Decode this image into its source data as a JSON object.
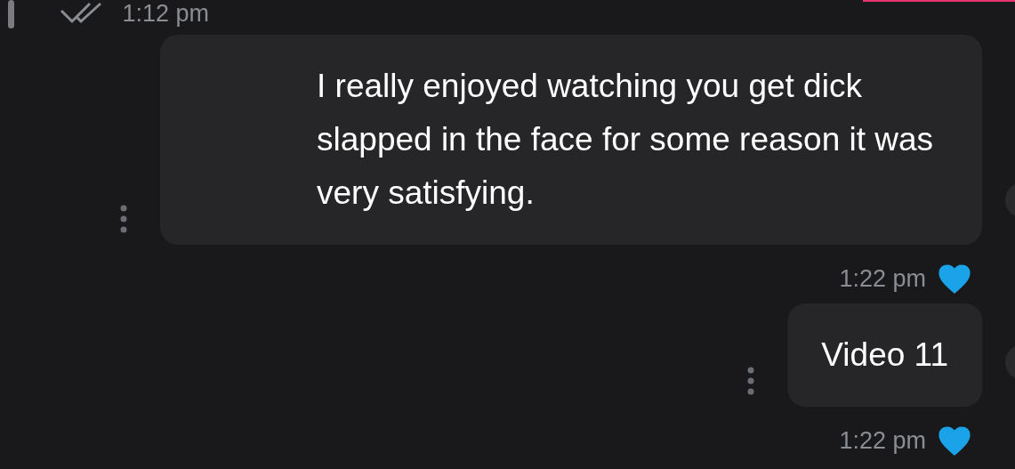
{
  "previous_message": {
    "time": "1:12 pm",
    "read": true
  },
  "messages": [
    {
      "text": "I really enjoyed watching you get dick slapped in the face for some reason it was very satisfying.",
      "time": "1:22 pm",
      "liked": true
    },
    {
      "text": "Video 11",
      "time": "1:22 pm",
      "liked": true
    }
  ]
}
